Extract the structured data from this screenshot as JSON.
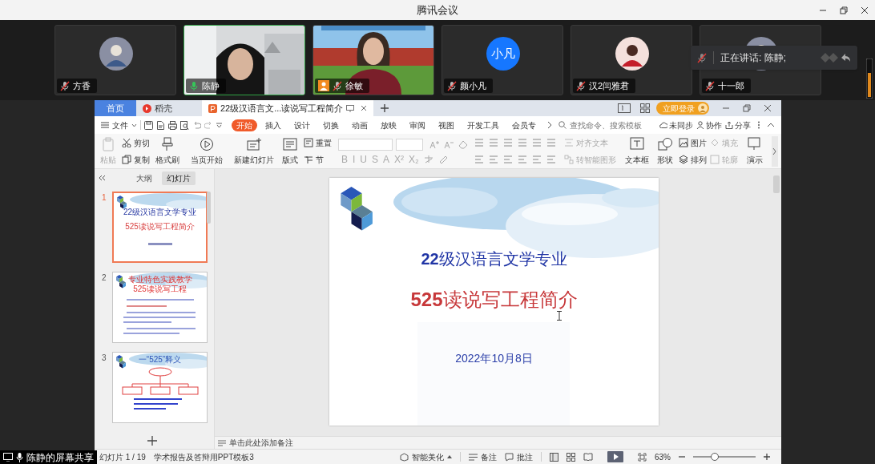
{
  "window": {
    "title": "腾讯会议"
  },
  "participants": [
    {
      "name": "方香",
      "kind": "avatar",
      "muted": true,
      "selected": false,
      "host": false
    },
    {
      "name": "陈静",
      "kind": "video",
      "muted": false,
      "selected": true,
      "host": false
    },
    {
      "name": "徐敏",
      "kind": "video",
      "muted": true,
      "selected": false,
      "host": true
    },
    {
      "name": "颜小凡",
      "kind": "initials",
      "initials": "小凡",
      "muted": true,
      "selected": false,
      "host": false
    },
    {
      "name": "汉2闫雅君",
      "kind": "avatar",
      "muted": true,
      "selected": false,
      "host": false
    },
    {
      "name": "十一郎",
      "kind": "avatar",
      "muted": true,
      "selected": false,
      "host": false
    }
  ],
  "speaking_popup": {
    "text": "正在讲话: 陈静;"
  },
  "share_label": "陈静的屏幕共享",
  "wps": {
    "tabs": [
      {
        "label": "首页",
        "kind": "home",
        "selected": false
      },
      {
        "label": "稻壳",
        "kind": "docer",
        "selected": false
      },
      {
        "label": "22级汉语言文...读说写工程简介",
        "kind": "doc",
        "selected": true
      }
    ],
    "login_button": "立即登录",
    "file_menu": "文件",
    "ribbon_tabs": [
      {
        "label": "开始",
        "selected": true
      },
      {
        "label": "插入",
        "selected": false
      },
      {
        "label": "设计",
        "selected": false
      },
      {
        "label": "切换",
        "selected": false
      },
      {
        "label": "动画",
        "selected": false
      },
      {
        "label": "放映",
        "selected": false
      },
      {
        "label": "审阅",
        "selected": false
      },
      {
        "label": "视图",
        "selected": false
      },
      {
        "label": "开发工具",
        "selected": false
      },
      {
        "label": "会员专",
        "selected": false
      }
    ],
    "search_placeholder": "查找命令、搜索模板",
    "actions": [
      "未同步",
      "协作",
      "分享"
    ],
    "ribbon": [
      {
        "kind": "large",
        "label": "粘贴",
        "disabled": true
      },
      {
        "kind": "stack",
        "items": [
          {
            "label": "剪切",
            "disabled": false
          },
          {
            "label": "复制",
            "disabled": false
          }
        ]
      },
      {
        "kind": "large",
        "label": "格式刷",
        "disabled": false
      },
      {
        "kind": "separator"
      },
      {
        "kind": "large",
        "label": "当页开始",
        "disabled": false
      },
      {
        "kind": "separator"
      },
      {
        "kind": "large",
        "label": "新建幻灯片",
        "disabled": false
      },
      {
        "kind": "large",
        "label": "版式",
        "disabled": false
      },
      {
        "kind": "stack",
        "items": [
          {
            "label": "重置",
            "disabled": false
          },
          {
            "label": "节",
            "disabled": false
          }
        ]
      },
      {
        "kind": "separator"
      },
      {
        "kind": "font",
        "buttons": [
          "B",
          "I",
          "U",
          "S",
          "A",
          "X²",
          "X₂"
        ]
      },
      {
        "kind": "separator"
      },
      {
        "kind": "paragraph",
        "items": [
          {
            "label": "对齐文本",
            "disabled": true
          },
          {
            "label": "转智能图形",
            "disabled": true
          }
        ]
      },
      {
        "kind": "separator"
      },
      {
        "kind": "large",
        "label": "文本框",
        "disabled": false
      },
      {
        "kind": "large",
        "label": "形状",
        "disabled": false
      },
      {
        "kind": "stack",
        "items": [
          {
            "label": "图片",
            "disabled": false
          },
          {
            "label": "排列",
            "disabled": false
          }
        ]
      },
      {
        "kind": "stack",
        "items": [
          {
            "label": "填充",
            "disabled": true
          },
          {
            "label": "轮廓",
            "disabled": true
          }
        ]
      },
      {
        "kind": "separator"
      },
      {
        "kind": "large",
        "label": "演示",
        "disabled": false
      }
    ],
    "panel_tabs": [
      {
        "label": "大纲",
        "selected": false
      },
      {
        "label": "幻灯片",
        "selected": true
      }
    ],
    "thumbnails": [
      {
        "number": "1",
        "selected": true,
        "titles": [
          "22级汉语言文学专业",
          "525读说写工程简介"
        ]
      },
      {
        "number": "2",
        "selected": false,
        "titles": [
          "专业特色实践教学",
          "525读说写工程"
        ]
      },
      {
        "number": "3",
        "selected": false,
        "titles": [
          "一“525”释义"
        ]
      }
    ],
    "slide": {
      "title": "**22**级汉语言文学专业",
      "subtitle": "**525**读说写工程简介",
      "date": "2022年10月8日"
    },
    "notes_placeholder": "单击此处添加备注",
    "status": {
      "slide_count": "幻灯片 1 / 19",
      "template": "学术报告及答辩用PPT模板3",
      "beautify": "智能美化",
      "notes": "备注",
      "comments": "批注",
      "zoom": "63%",
      "zoom_slider": {
        "level": 0.35
      }
    }
  }
}
